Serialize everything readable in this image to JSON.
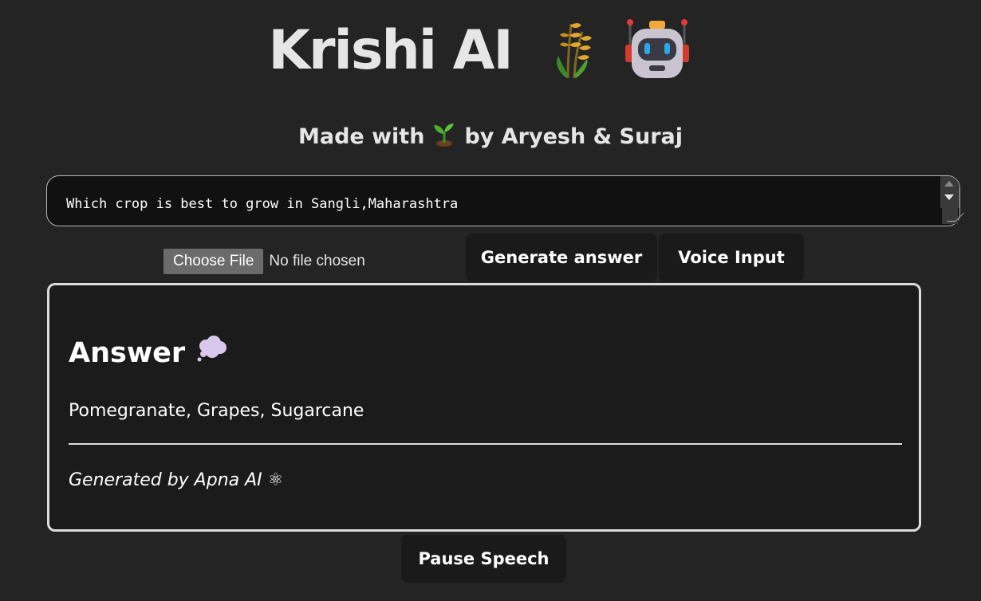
{
  "header": {
    "title": "Krishi AI",
    "subtitle_prefix": "Made with",
    "subtitle_suffix": "by Aryesh & Suraj",
    "title_icons": [
      "wheat-icon",
      "robot-icon"
    ],
    "subtitle_icon": "seedling-icon"
  },
  "prompt": {
    "value": "Which crop is best to grow in Sangli,Maharashtra"
  },
  "file_input": {
    "button_label": "Choose File",
    "status": "No file chosen"
  },
  "actions": {
    "generate_label": "Generate answer",
    "voice_label": "Voice Input",
    "pause_label": "Pause Speech"
  },
  "answer": {
    "heading": "Answer",
    "heading_icon": "thought-bubble-icon",
    "text": "Pomegranate, Grapes, Sugarcane",
    "footer": "Generated by Apna AI ⚛"
  },
  "colors": {
    "background": "#242424",
    "card_background": "#1b1b1b",
    "button_background": "#1a1a1a",
    "card_border": "#dcdcdc"
  }
}
